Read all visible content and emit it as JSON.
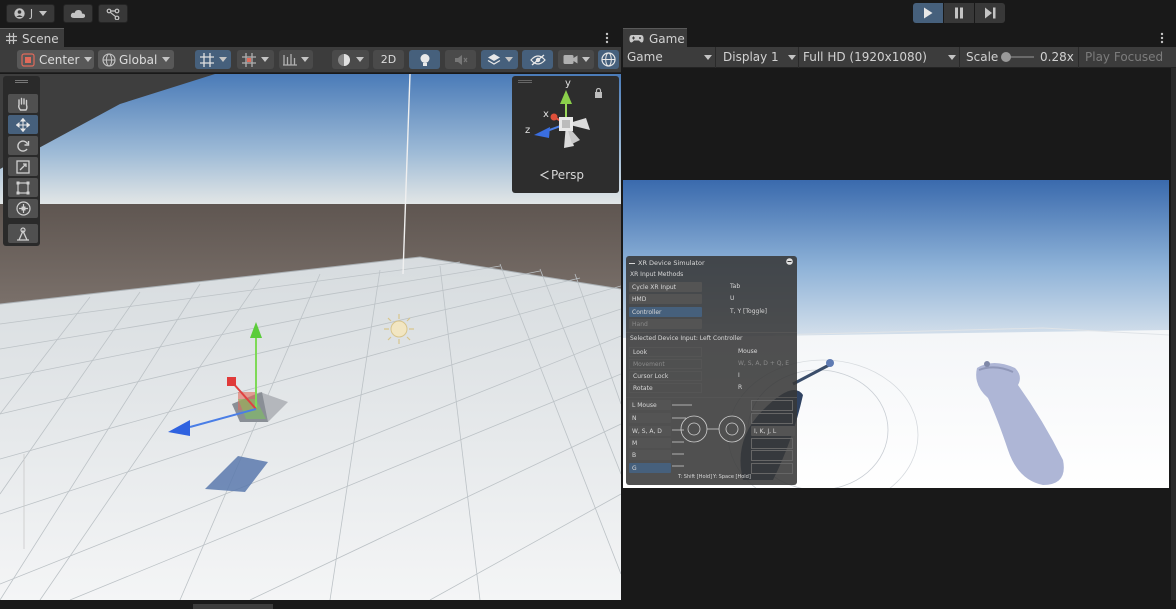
{
  "topbar": {
    "account_label": "J",
    "cloud_icon": "cloud-icon",
    "collab_icon": "version-control-icon",
    "play_icon": "play-icon",
    "pause_icon": "pause-icon",
    "step_icon": "step-icon"
  },
  "scene": {
    "tab_label": "Scene",
    "pivot_label": "Center",
    "space_label": "Global",
    "mode_2d": "2D",
    "gizmo": {
      "y": "y",
      "x": "x",
      "z": "z",
      "projection": "Persp"
    }
  },
  "game": {
    "tab_label": "Game",
    "view_select": "Game",
    "display_select": "Display 1",
    "resolution_select": "Full HD (1920x1080)",
    "scale_label": "Scale",
    "scale_value": "0.28x",
    "scale_fraction": 0.05,
    "play_focused": "Play Focused"
  },
  "xr_sim": {
    "title": "XR Device Simulator",
    "input_methods_label": "XR Input Methods",
    "methods": [
      {
        "label": "Cycle XR Input",
        "key": "Tab"
      },
      {
        "label": "HMD",
        "key": "U"
      },
      {
        "label": "Controller",
        "key": "T, Y [Toggle]"
      },
      {
        "label": "Hand",
        "key": ""
      }
    ],
    "selected_label": "Selected Device Input: Left Controller",
    "controls": [
      {
        "label": "Look",
        "key": "Mouse"
      },
      {
        "label": "Movement",
        "key": "W, S, A, D + Q, E"
      },
      {
        "label": "Cursor Lock",
        "key": "I"
      },
      {
        "label": "Rotate",
        "key": "R"
      }
    ],
    "bindings": [
      "L Mouse",
      "N",
      "W, S, A, D",
      "M",
      "B",
      "G"
    ],
    "right_binding": "I, K, J, L",
    "footer_left": "T: Shift [Hold]",
    "footer_right": "Y: Space [Hold]"
  },
  "colors": {
    "accent": "#46607c",
    "panel": "#3c3c3c",
    "background": "#191919"
  }
}
